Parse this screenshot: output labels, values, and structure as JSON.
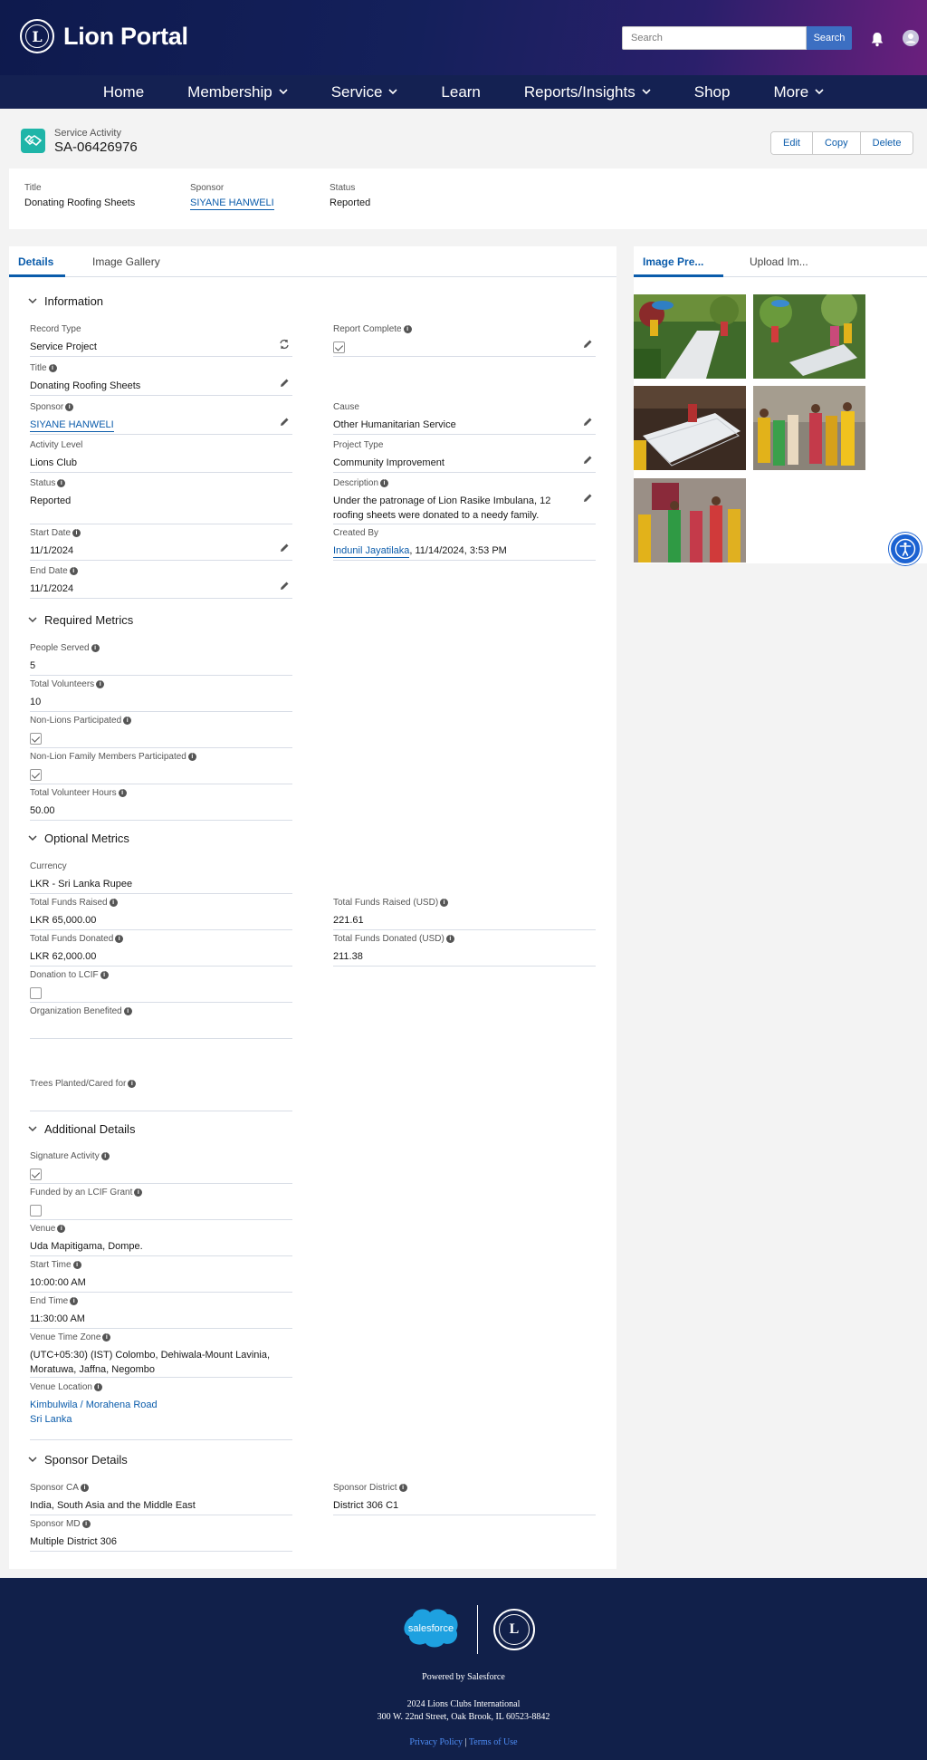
{
  "header": {
    "logo_mark": "L",
    "portal_title": "Lion Portal",
    "search_placeholder": "Search",
    "search_button": "Search"
  },
  "nav": {
    "items": [
      {
        "label": "Home",
        "dropdown": false
      },
      {
        "label": "Membership",
        "dropdown": true
      },
      {
        "label": "Service",
        "dropdown": true
      },
      {
        "label": "Learn",
        "dropdown": false
      },
      {
        "label": "Reports/Insights",
        "dropdown": true
      },
      {
        "label": "Shop",
        "dropdown": false
      },
      {
        "label": "More",
        "dropdown": true
      }
    ]
  },
  "record": {
    "object_type": "Service Activity",
    "name": "SA-06426976",
    "actions": {
      "edit": "Edit",
      "copy": "Copy",
      "delete": "Delete"
    },
    "highlights": {
      "title_label": "Title",
      "title_value": "Donating Roofing Sheets",
      "sponsor_label": "Sponsor",
      "sponsor_value": "SIYANE HANWELI",
      "status_label": "Status",
      "status_value": "Reported"
    }
  },
  "tabs": {
    "details": "Details",
    "gallery": "Image Gallery"
  },
  "side_tabs": {
    "preview": "Image Pre...",
    "upload": "Upload Im..."
  },
  "sections": {
    "information": "Information",
    "required": "Required Metrics",
    "optional": "Optional Metrics",
    "additional": "Additional Details",
    "sponsor": "Sponsor Details"
  },
  "fields": {
    "record_type": {
      "label": "Record Type",
      "value": "Service Project"
    },
    "report_complete": {
      "label": "Report Complete",
      "checked": true
    },
    "title": {
      "label": "Title",
      "value": "Donating Roofing Sheets"
    },
    "sponsor": {
      "label": "Sponsor",
      "value": "SIYANE HANWELI"
    },
    "cause": {
      "label": "Cause",
      "value": "Other Humanitarian Service"
    },
    "activity_level": {
      "label": "Activity Level",
      "value": "Lions Club"
    },
    "project_type": {
      "label": "Project Type",
      "value": "Community Improvement"
    },
    "status": {
      "label": "Status",
      "value": "Reported"
    },
    "description": {
      "label": "Description",
      "value": "Under the patronage of Lion Rasike Imbulana, 12 roofing sheets were donated to a needy family."
    },
    "start_date": {
      "label": "Start Date",
      "value": "11/1/2024"
    },
    "created_by": {
      "label": "Created By",
      "user": "Indunil Jayatilaka",
      "when": ", 11/14/2024, 3:53 PM"
    },
    "end_date": {
      "label": "End Date",
      "value": "11/1/2024"
    },
    "people_served": {
      "label": "People Served",
      "value": "5"
    },
    "total_volunteers": {
      "label": "Total Volunteers",
      "value": "10"
    },
    "non_lions": {
      "label": "Non-Lions Participated",
      "checked": true
    },
    "non_lion_family": {
      "label": "Non-Lion Family Members Participated",
      "checked": true
    },
    "volunteer_hours": {
      "label": "Total Volunteer Hours",
      "value": "50.00"
    },
    "currency": {
      "label": "Currency",
      "value": "LKR - Sri Lanka Rupee"
    },
    "funds_raised": {
      "label": "Total Funds Raised",
      "value": "LKR 65,000.00"
    },
    "funds_raised_usd": {
      "label": "Total Funds Raised (USD)",
      "value": "221.61"
    },
    "funds_donated": {
      "label": "Total Funds Donated",
      "value": "LKR 62,000.00"
    },
    "funds_donated_usd": {
      "label": "Total Funds Donated (USD)",
      "value": "211.38"
    },
    "donation_lcif": {
      "label": "Donation to LCIF",
      "checked": false
    },
    "org_benefited": {
      "label": "Organization Benefited",
      "value": ""
    },
    "trees": {
      "label": "Trees Planted/Cared for",
      "value": ""
    },
    "signature": {
      "label": "Signature Activity",
      "checked": true
    },
    "lcif_grant": {
      "label": "Funded by an LCIF Grant",
      "checked": false
    },
    "venue": {
      "label": "Venue",
      "value": "Uda Mapitigama, Dompe."
    },
    "start_time": {
      "label": "Start Time",
      "value": "10:00:00 AM"
    },
    "end_time": {
      "label": "End Time",
      "value": "11:30:00 AM"
    },
    "venue_tz": {
      "label": "Venue Time Zone",
      "value": "(UTC+05:30) (IST) Colombo, Dehiwala-Mount Lavinia, Moratuwa, Jaffna, Negombo"
    },
    "venue_location": {
      "label": "Venue Location",
      "part1": "Kimbulwila",
      "sep": " / ",
      "part2": "Morahena Road",
      "part3": "Sri Lanka"
    },
    "sponsor_ca": {
      "label": "Sponsor CA",
      "value": "India, South Asia and the Middle East"
    },
    "sponsor_district": {
      "label": "Sponsor District",
      "value": "District 306 C1"
    },
    "sponsor_md": {
      "label": "Sponsor MD",
      "value": "Multiple District 306"
    }
  },
  "footer": {
    "salesforce_logo": "salesforce",
    "lions_mark": "L",
    "powered": "Powered by Salesforce",
    "copyright": "2024 Lions Clubs International",
    "address": "300 W. 22nd Street, Oak Brook, IL 60523-8842",
    "privacy": "Privacy Policy",
    "separator": " | ",
    "terms": "Terms of Use"
  },
  "icons": {
    "record": "handshake-icon",
    "bell": "bell-icon",
    "user": "user-avatar-icon",
    "edit": "pencil-icon",
    "change": "change-record-type-icon",
    "chevron": "chevron-down-icon",
    "info": "info-icon",
    "accessibility": "accessibility-icon"
  },
  "colors": {
    "brand_blue": "#0b5cab",
    "nav_bg": "#142152",
    "footer_bg": "#11204a",
    "record_icon": "#1fb5a8"
  }
}
